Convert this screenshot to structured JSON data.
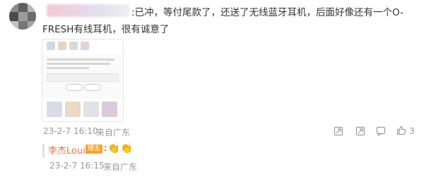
{
  "comment": {
    "text": ":已冲，等付尾款了，还送了无线蓝牙耳机，后面好像还有一个O-FRESH有线耳机，很有诚意了",
    "date": "23-2-7 16:10",
    "location": "来自广东",
    "like_count": "3",
    "icons": [
      "blurred-avatar",
      "share-icon",
      "comment-icon",
      "thumbs-up-icon"
    ]
  },
  "reply": {
    "author": "李杰Louis",
    "badge": "博主",
    "text": ":",
    "emoji": [
      "👏",
      "👏"
    ],
    "date": "23-2-7 16:15",
    "location": "来自广东"
  },
  "colors": {
    "author_link": "#eb7350",
    "badge_bg": "#f8a32f",
    "meta_text": "#999999"
  }
}
